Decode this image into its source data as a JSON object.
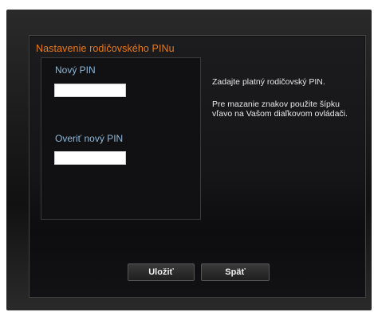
{
  "dialog": {
    "title": "Nastavenie rodičovského PINu"
  },
  "fields": {
    "new_pin_label": "Nový PIN",
    "new_pin_value": "",
    "verify_pin_label": "Overiť nový PIN",
    "verify_pin_value": ""
  },
  "help": {
    "line1": "Zadajte platný rodičovský PIN.",
    "line2": "Pre mazanie znakov použite šípku vľavo na Vašom diaľkovom ovládači."
  },
  "buttons": {
    "save_label": "Uložiť",
    "back_label": "Späť"
  },
  "colors": {
    "title": "#e87a1f",
    "field_label": "#8fb8d8"
  }
}
